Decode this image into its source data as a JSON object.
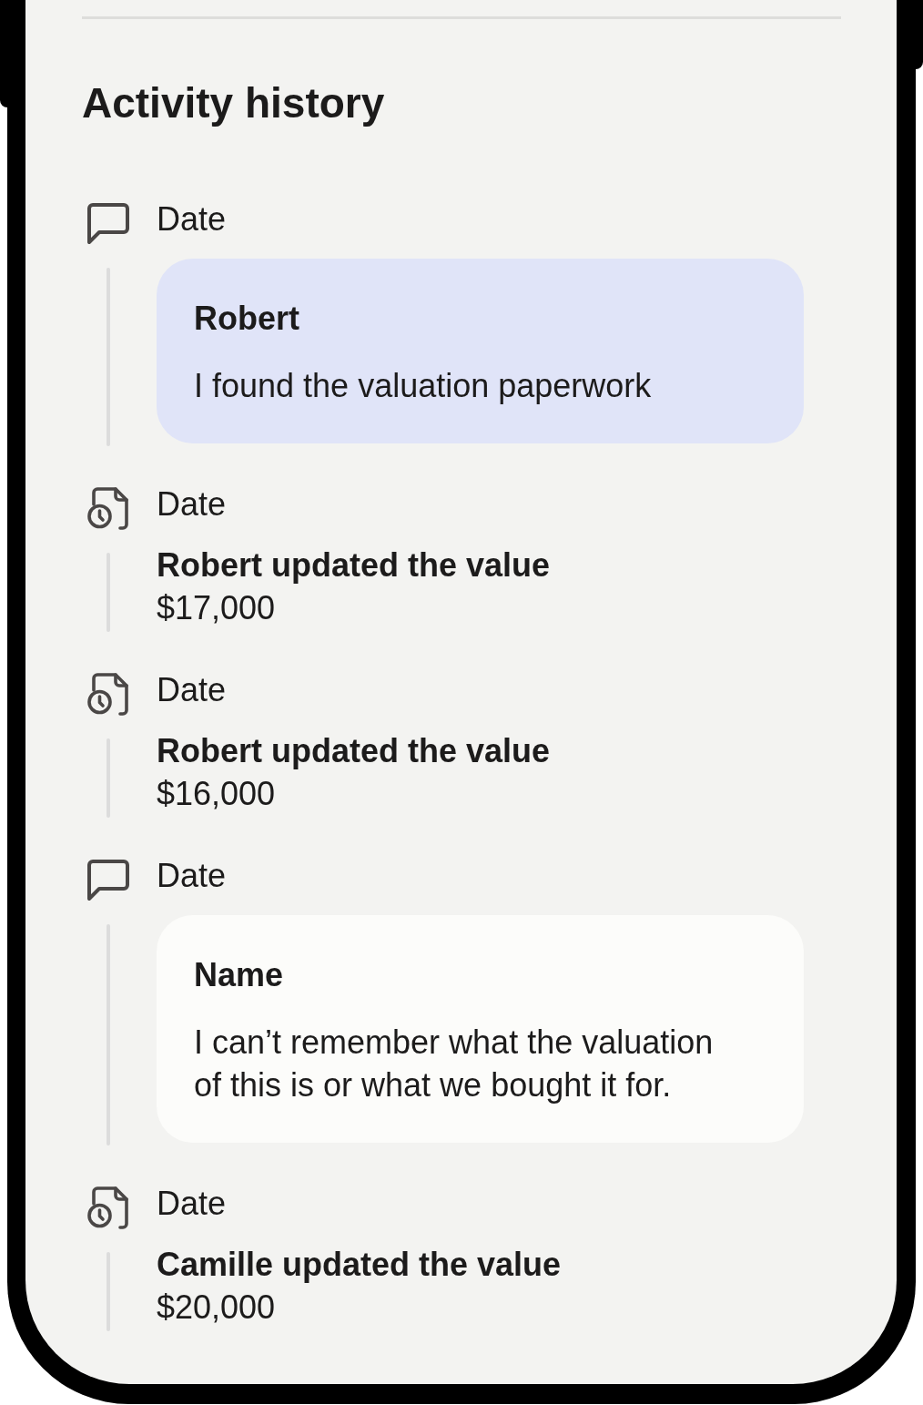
{
  "section": {
    "title": "Activity history"
  },
  "activity": [
    {
      "kind": "comment",
      "date": "Date",
      "author": "Robert",
      "message": "I found the valuation paperwork",
      "highlighted": true
    },
    {
      "kind": "value_update",
      "date": "Date",
      "summary": "Robert updated the value",
      "value": "$17,000"
    },
    {
      "kind": "value_update",
      "date": "Date",
      "summary": "Robert updated the value",
      "value": "$16,000"
    },
    {
      "kind": "comment",
      "date": "Date",
      "author": "Name",
      "message": "I can’t remember what the valuation of this is or what we bought it for.",
      "highlighted": false
    },
    {
      "kind": "value_update",
      "date": "Date",
      "summary": "Camille updated the value",
      "value": "$20,000"
    }
  ]
}
